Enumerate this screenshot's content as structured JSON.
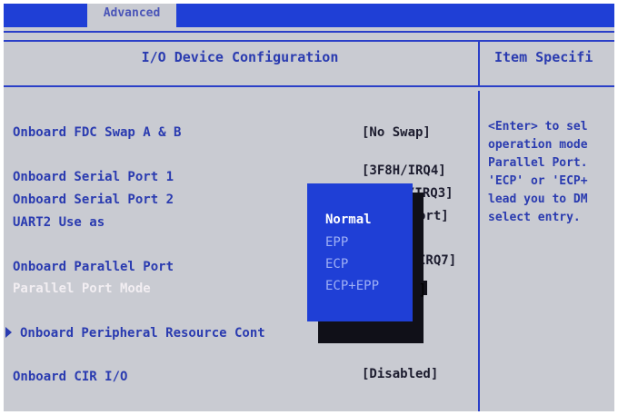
{
  "tabs": {
    "advanced": "Advanced"
  },
  "header": {
    "title": "I/O Device Configuration",
    "help_title": "Item Specifi"
  },
  "settings": [
    {
      "label": "Onboard FDC Swap A & B",
      "value": "[No Swap]"
    },
    {
      "label": "Onboard Serial Port 1",
      "value": "[3F8H/IRQ4]"
    },
    {
      "label": "Onboard Serial Port 2",
      "value": "/IRQ3]"
    },
    {
      "label": "UART2 Use as",
      "value": "ort]"
    },
    {
      "label": "Onboard Parallel Port",
      "value": "IRQ7]"
    },
    {
      "label": "Parallel Port Mode",
      "value": "]"
    },
    {
      "label": "Onboard Peripheral Resource Cont"
    },
    {
      "label": "Onboard CIR I/O",
      "value": "[Disabled]"
    }
  ],
  "popup": {
    "options": [
      "Normal",
      "EPP",
      "ECP",
      "ECP+EPP"
    ],
    "selected": "Normal"
  },
  "help_lines": [
    "<Enter> to sel",
    "operation mode",
    "Parallel Port.",
    "'ECP' or 'ECP+",
    "lead you to DM",
    "select entry."
  ],
  "colors": {
    "bios_blue": "#1f3fd6",
    "background": "#c9cbd2",
    "label_blue": "#2a3bb0"
  }
}
